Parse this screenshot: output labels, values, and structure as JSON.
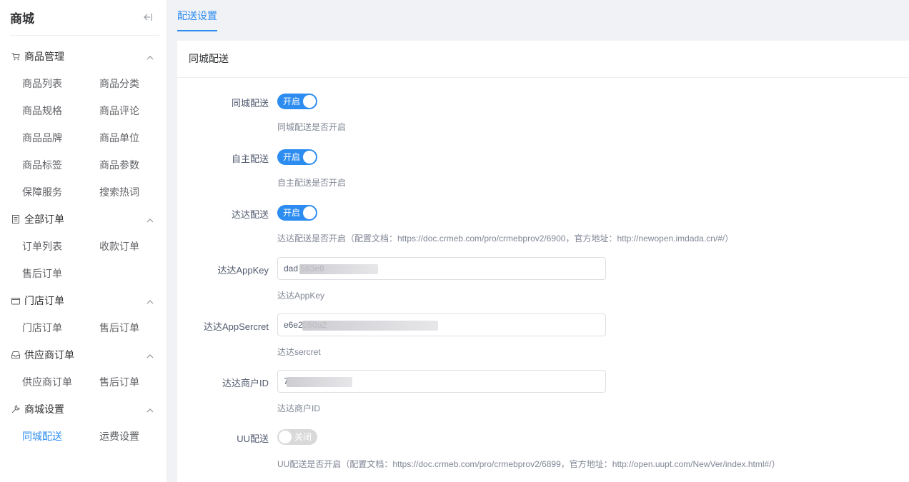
{
  "sidebar": {
    "title": "商城",
    "groups": [
      {
        "label": "商品管理",
        "icon": "cart-icon",
        "items": [
          "商品列表",
          "商品分类",
          "商品规格",
          "商品评论",
          "商品品牌",
          "商品单位",
          "商品标签",
          "商品参数",
          "保障服务",
          "搜索热词"
        ]
      },
      {
        "label": "全部订单",
        "icon": "document-icon",
        "items": [
          "订单列表",
          "收款订单",
          "售后订单"
        ]
      },
      {
        "label": "门店订单",
        "icon": "store-icon",
        "items": [
          "门店订单",
          "售后订单"
        ]
      },
      {
        "label": "供应商订单",
        "icon": "inbox-icon",
        "items": [
          "供应商订单",
          "售后订单"
        ]
      },
      {
        "label": "商城设置",
        "icon": "wrench-icon",
        "items": [
          "同城配送",
          "运费设置"
        ]
      }
    ],
    "active_item": "同城配送"
  },
  "tabs": [
    {
      "label": "配送设置"
    }
  ],
  "card": {
    "title": "同城配送",
    "fields": {
      "city_delivery": {
        "label": "同城配送",
        "switch_text": "开启",
        "hint": "同城配送是否开启",
        "on": true
      },
      "self_delivery": {
        "label": "自主配送",
        "switch_text": "开启",
        "hint": "自主配送是否开启",
        "on": true
      },
      "dada_delivery": {
        "label": "达达配送",
        "switch_text": "开启",
        "hint": "达达配送是否开启（配置文档：https://doc.crmeb.com/pro/crmebprov2/6900，官方地址：http://newopen.imdada.cn/#/）",
        "on": true
      },
      "dada_appkey": {
        "label": "达达AppKey",
        "value": "dad 563e8",
        "hint": "达达AppKey"
      },
      "dada_appsecret": {
        "label": "达达AppSercret",
        "value": "e6e2050a2",
        "hint": "达达sercret"
      },
      "dada_merchant_id": {
        "label": "达达商户ID",
        "value": "7",
        "hint": "达达商户ID"
      },
      "uu_delivery": {
        "label": "UU配送",
        "switch_text": "关闭",
        "hint": "UU配送是否开启（配置文档：https://doc.crmeb.com/pro/crmebprov2/6899，官方地址：http://open.uupt.com/NewVer/index.html#/）",
        "on": false
      }
    }
  },
  "colors": {
    "accent": "#2d8cf0",
    "switch_off": "#d9d9d9"
  }
}
